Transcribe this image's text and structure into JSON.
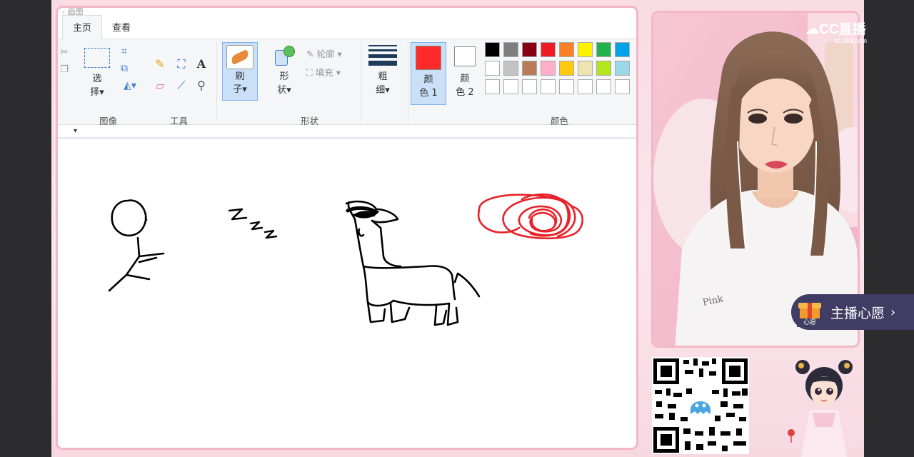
{
  "paint": {
    "title": "- 画图",
    "tabs": [
      "主页",
      "查看"
    ],
    "ribbon": {
      "select_label": "选\n择▾",
      "group_image": "图像",
      "group_tools": "工具",
      "brushes_label": "刷\n子▾",
      "shapes_label": "形\n状▾",
      "outline_label": "轮廓",
      "fill_label": "填充",
      "group_shapes": "形状",
      "size_label": "粗\n细▾",
      "color1_label": "颜\n色 1",
      "color2_label": "颜\n色 2",
      "group_colors": "颜色",
      "color1_value": "#ff2a2a",
      "palette_row1": [
        "#000000",
        "#7f7f7f",
        "#880015",
        "#ed1c24",
        "#ff7f27",
        "#fff200",
        "#22b14c",
        "#00a2e8"
      ],
      "palette_row2": [
        "#ffffff",
        "#c3c3c3",
        "#b97a57",
        "#ffaec9",
        "#ffc90e",
        "#efe4b0",
        "#b5e61d",
        "#99d9ea"
      ],
      "palette_row3": [
        "#ffffff",
        "#ffffff",
        "#ffffff",
        "#ffffff",
        "#ffffff",
        "#ffffff",
        "#ffffff",
        "#ffffff"
      ]
    }
  },
  "overlay": {
    "logo_text": "CC直播",
    "logo_url": "cc.163.com",
    "wish_label": "主播心愿",
    "wish_icon_caption": "心愿"
  }
}
